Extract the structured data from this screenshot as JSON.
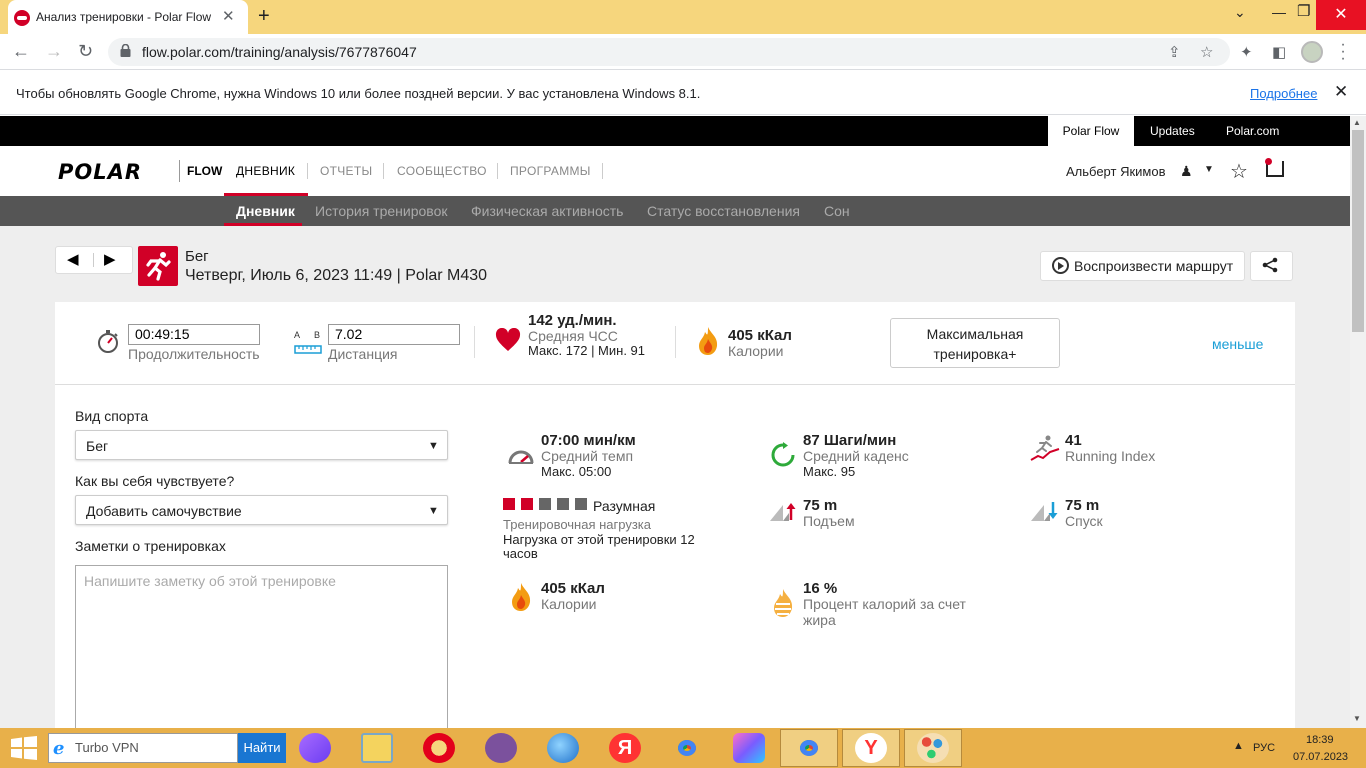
{
  "browser": {
    "tab_title": "Анализ тренировки - Polar Flow",
    "url": "flow.polar.com/training/analysis/7677876047",
    "infobar_text": "Чтобы обновлять Google Chrome, нужна Windows 10 или более поздней версии. У вас установлена Windows 8.1.",
    "infobar_link": "Подробнее"
  },
  "topbar": {
    "links": [
      "Polar Flow",
      "Updates",
      "Polar.com"
    ]
  },
  "header": {
    "logo": "POLAR",
    "app": "FLOW",
    "nav": [
      "ДНЕВНИК",
      "ОТЧЕТЫ",
      "СООБЩЕСТВО",
      "ПРОГРАММЫ"
    ],
    "user_name": "Альберт Якимов"
  },
  "subnav": [
    "Дневник",
    "История тренировок",
    "Физическая активность",
    "Статус восстановления",
    "Сон"
  ],
  "session": {
    "sport": "Бег",
    "datetime": "Четверг, Июль 6, 2023 11:49 | Polar M430",
    "replay_label": "Воспроизвести маршрут"
  },
  "summary": {
    "duration": "00:49:15",
    "duration_label": "Продолжительность",
    "ab_a": "A",
    "ab_b": "B",
    "distance": "7.02",
    "distance_label": "Дистанция",
    "hr_value": "142 уд./мин.",
    "hr_label": "Средняя ЧСС",
    "hr_minmax": "Макс. 172  |  Мин. 91",
    "calories": "405 кКал",
    "calories_label": "Калории",
    "max_training": "Максимальная тренировка+",
    "less_link": "меньше"
  },
  "form": {
    "sport_label": "Вид спорта",
    "sport_value": "Бег",
    "feeling_label": "Как вы себя чувствуете?",
    "feeling_value": "Добавить самочувствие",
    "notes_label": "Заметки о тренировках",
    "notes_placeholder": "Напишите заметку об этой тренировке"
  },
  "metrics": {
    "pace_value": "07:00 мин/км",
    "pace_label": "Средний темп",
    "pace_max": "Макс. 05:00",
    "cadence_value": "87 Шаги/мин",
    "cadence_label": "Средний каденс",
    "cadence_max": "Макс. 95",
    "ri_value": "41",
    "ri_label": "Running Index",
    "load_text": "Разумная",
    "load_level": 2,
    "load_max": 5,
    "load_label": "Тренировочная нагрузка",
    "load_desc": "Нагрузка от этой тренировки 12 часов",
    "ascent_value": "75 m",
    "ascent_label": "Подъем",
    "descent_value": "75 m",
    "descent_label": "Спуск",
    "cal_value": "405 кКал",
    "cal_label": "Калории",
    "fat_value": "16 %",
    "fat_label": "Процент калорий за счет жира"
  },
  "taskbar": {
    "search_text": "Turbo VPN",
    "search_button": "Найти",
    "lang": "РУС",
    "time": "18:39",
    "date": "07.07.2023"
  },
  "colors": {
    "brand_red": "#d10027",
    "link_blue": "#1a9ed6",
    "taskbar": "#e8b04a",
    "tabstrip": "#f6d67d"
  }
}
